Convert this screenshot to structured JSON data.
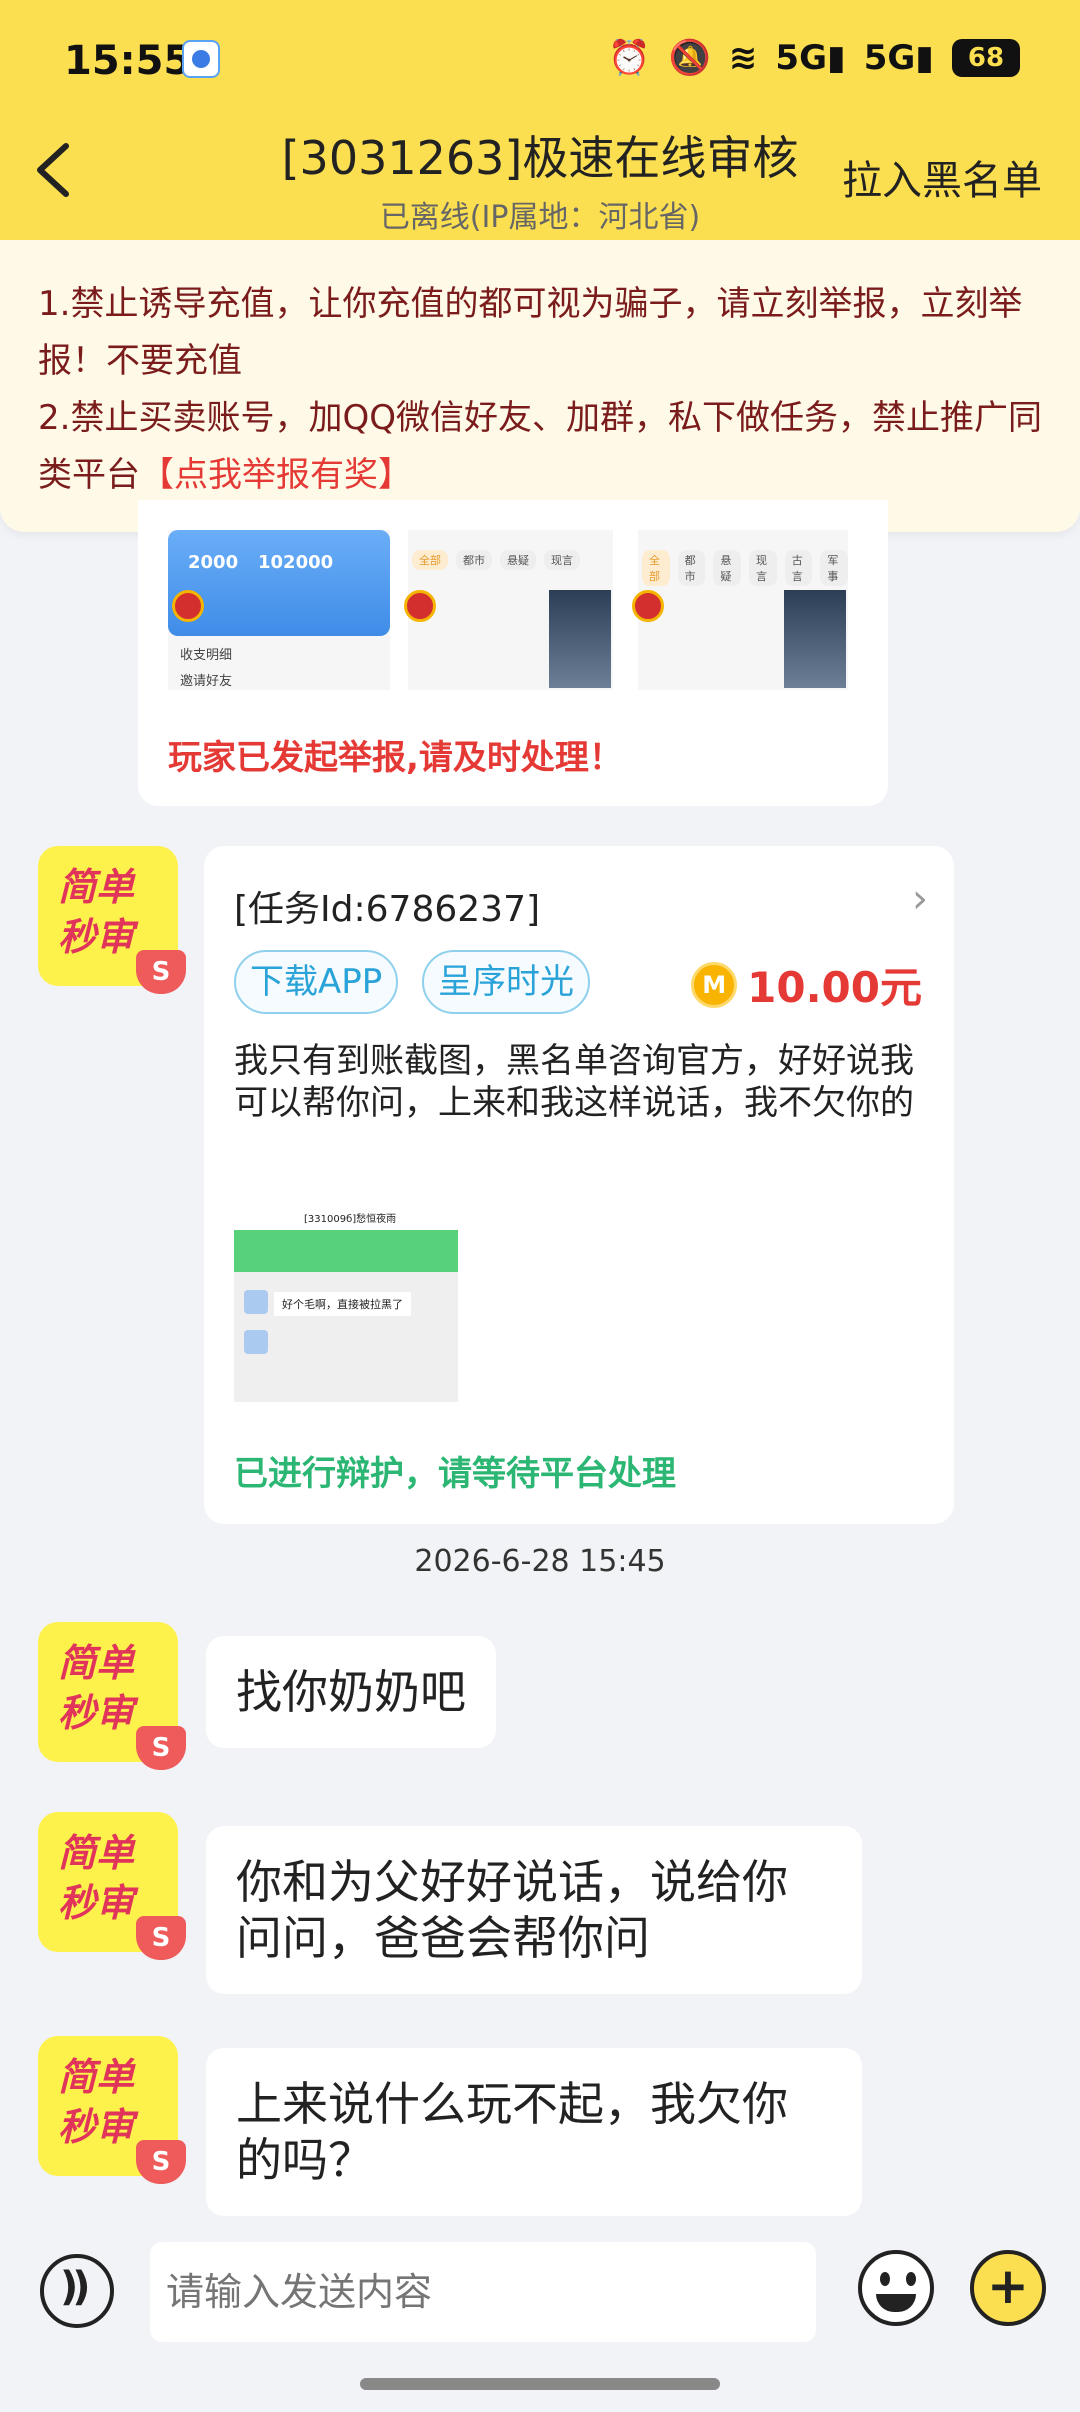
{
  "status_bar": {
    "time": "15:55",
    "signal1": "5G",
    "signal2": "5G",
    "battery": "68"
  },
  "header": {
    "title": "[3031263]极速在线审核",
    "subtitle": "已离线(IP属地：河北省)",
    "action": "拉入黑名单"
  },
  "notice": {
    "line1": "1.禁止诱导充值，让你充值的都可视为骗子，请立刻举报，立刻举报！不要充值",
    "line2": "2.禁止买卖账号，加QQ微信好友、加群，私下做任务，禁止推广同类平台",
    "link": "【点我举报有奖】"
  },
  "report_card": {
    "thumb_num1": "2000",
    "thumb_num2": "102000",
    "thumb_row1": "收支明细",
    "thumb_row2": "邀请好友",
    "tags": [
      "全部",
      "都市",
      "悬疑",
      "现言",
      "古言",
      "军事"
    ],
    "status": "玩家已发起举报,请及时处理！"
  },
  "avatar_text": {
    "line1": "简单",
    "line2": "秒审",
    "badge": "S"
  },
  "task_card": {
    "task_id": "[任务Id:6786237]",
    "tag1": "下载APP",
    "tag2": "呈序时光",
    "coin": "M",
    "amount": "10.00元",
    "message": "我只有到账截图，黑名单咨询官方，好好说我可以帮你问，上来和我这样说话，我不欠你的",
    "shot_title": "[331009б]愁恒夜雨",
    "shot_bubble": "好个毛啊，直接被拉黑了",
    "status": "已进行辩护，请等待平台处理"
  },
  "timestamp": "2026-6-28 15:45",
  "messages": [
    {
      "text": "找你奶奶吧"
    },
    {
      "text": "你和为父好好说话，说给你问问，爸爸会帮你问"
    },
    {
      "text": "上来说什么玩不起，我欠你的吗？"
    }
  ],
  "input": {
    "placeholder": "请输入发送内容"
  }
}
